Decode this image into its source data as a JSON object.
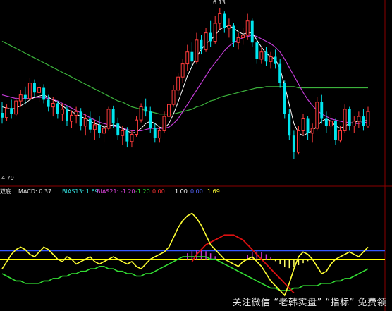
{
  "header": {
    "indicator_label": "双底",
    "macd_label": "MACD: 0.37",
    "bias13_label": "BIAS13: 1.69",
    "bias21_label": "BIAS21: -1.20",
    "extra_value_1": "-1.20",
    "extra_value_2": "0.00",
    "extra_value_3": "1.00",
    "extra_value_4": "0.00",
    "extra_value_5": "1.69"
  },
  "price_panel": {
    "high_label": "6.13",
    "low_label": "4.79"
  },
  "watermark": "关注微信 “老韩实盘” “指标” 免费领",
  "colors": {
    "up": "#ff3b3b",
    "down": "#00e5ee",
    "ma_short": "#ffffff",
    "ma_mid": "#c23bd6",
    "ma_long": "#3cb33c",
    "grid": "#8b0000",
    "bias_fast": "#ffff33",
    "bias_slow": "#33dd33",
    "bias_red": "#dd1111",
    "baseline_blue": "#3355ff",
    "baseline_yellow": "#ffff00"
  },
  "chart_data": {
    "type": "candlestick",
    "title": "",
    "candles": [
      {
        "o": 5.25,
        "h": 5.34,
        "l": 5.16,
        "c": 5.21
      },
      {
        "o": 5.21,
        "h": 5.32,
        "l": 5.18,
        "c": 5.29
      },
      {
        "o": 5.29,
        "h": 5.36,
        "l": 5.2,
        "c": 5.24
      },
      {
        "o": 5.24,
        "h": 5.38,
        "l": 5.22,
        "c": 5.35
      },
      {
        "o": 5.35,
        "h": 5.44,
        "l": 5.3,
        "c": 5.4
      },
      {
        "o": 5.4,
        "h": 5.47,
        "l": 5.32,
        "c": 5.37
      },
      {
        "o": 5.37,
        "h": 5.54,
        "l": 5.35,
        "c": 5.5
      },
      {
        "o": 5.5,
        "h": 5.53,
        "l": 5.38,
        "c": 5.42
      },
      {
        "o": 5.42,
        "h": 5.5,
        "l": 5.34,
        "c": 5.46
      },
      {
        "o": 5.46,
        "h": 5.49,
        "l": 5.33,
        "c": 5.36
      },
      {
        "o": 5.36,
        "h": 5.4,
        "l": 5.26,
        "c": 5.3
      },
      {
        "o": 5.3,
        "h": 5.38,
        "l": 5.22,
        "c": 5.33
      },
      {
        "o": 5.33,
        "h": 5.35,
        "l": 5.2,
        "c": 5.24
      },
      {
        "o": 5.24,
        "h": 5.33,
        "l": 5.18,
        "c": 5.28
      },
      {
        "o": 5.28,
        "h": 5.31,
        "l": 5.14,
        "c": 5.18
      },
      {
        "o": 5.18,
        "h": 5.27,
        "l": 5.12,
        "c": 5.23
      },
      {
        "o": 5.23,
        "h": 5.3,
        "l": 5.16,
        "c": 5.26
      },
      {
        "o": 5.26,
        "h": 5.29,
        "l": 5.1,
        "c": 5.14
      },
      {
        "o": 5.14,
        "h": 5.24,
        "l": 5.06,
        "c": 5.2
      },
      {
        "o": 5.2,
        "h": 5.26,
        "l": 5.08,
        "c": 5.11
      },
      {
        "o": 5.11,
        "h": 5.19,
        "l": 5.02,
        "c": 5.15
      },
      {
        "o": 5.15,
        "h": 5.22,
        "l": 5.04,
        "c": 5.08
      },
      {
        "o": 5.08,
        "h": 5.16,
        "l": 5.0,
        "c": 5.12
      },
      {
        "o": 5.12,
        "h": 5.3,
        "l": 5.1,
        "c": 5.28
      },
      {
        "o": 5.28,
        "h": 5.31,
        "l": 5.12,
        "c": 5.16
      },
      {
        "o": 5.16,
        "h": 5.21,
        "l": 5.02,
        "c": 5.06
      },
      {
        "o": 5.06,
        "h": 5.14,
        "l": 4.98,
        "c": 5.1
      },
      {
        "o": 5.1,
        "h": 5.13,
        "l": 4.96,
        "c": 5.01
      },
      {
        "o": 5.01,
        "h": 5.1,
        "l": 4.96,
        "c": 5.07
      },
      {
        "o": 5.07,
        "h": 5.22,
        "l": 5.05,
        "c": 5.19
      },
      {
        "o": 5.19,
        "h": 5.33,
        "l": 5.17,
        "c": 5.3
      },
      {
        "o": 5.3,
        "h": 5.37,
        "l": 5.22,
        "c": 5.26
      },
      {
        "o": 5.26,
        "h": 5.3,
        "l": 5.08,
        "c": 5.12
      },
      {
        "o": 5.12,
        "h": 5.16,
        "l": 5.0,
        "c": 5.04
      },
      {
        "o": 5.04,
        "h": 5.13,
        "l": 5.0,
        "c": 5.1
      },
      {
        "o": 5.1,
        "h": 5.26,
        "l": 5.08,
        "c": 5.22
      },
      {
        "o": 5.22,
        "h": 5.36,
        "l": 5.2,
        "c": 5.32
      },
      {
        "o": 5.32,
        "h": 5.48,
        "l": 5.3,
        "c": 5.44
      },
      {
        "o": 5.44,
        "h": 5.58,
        "l": 5.4,
        "c": 5.55
      },
      {
        "o": 5.55,
        "h": 5.7,
        "l": 5.5,
        "c": 5.66
      },
      {
        "o": 5.66,
        "h": 5.82,
        "l": 5.6,
        "c": 5.76
      },
      {
        "o": 5.76,
        "h": 5.84,
        "l": 5.62,
        "c": 5.68
      },
      {
        "o": 5.68,
        "h": 5.92,
        "l": 5.66,
        "c": 5.86
      },
      {
        "o": 5.86,
        "h": 5.9,
        "l": 5.74,
        "c": 5.78
      },
      {
        "o": 5.78,
        "h": 5.96,
        "l": 5.76,
        "c": 5.92
      },
      {
        "o": 5.92,
        "h": 6.02,
        "l": 5.8,
        "c": 5.85
      },
      {
        "o": 5.85,
        "h": 6.06,
        "l": 5.83,
        "c": 6.0
      },
      {
        "o": 6.0,
        "h": 6.13,
        "l": 5.95,
        "c": 6.08
      },
      {
        "o": 6.08,
        "h": 6.1,
        "l": 5.92,
        "c": 5.96
      },
      {
        "o": 5.96,
        "h": 6.04,
        "l": 5.88,
        "c": 5.98
      },
      {
        "o": 5.98,
        "h": 6.0,
        "l": 5.8,
        "c": 5.84
      },
      {
        "o": 5.84,
        "h": 5.92,
        "l": 5.78,
        "c": 5.88
      },
      {
        "o": 5.88,
        "h": 5.96,
        "l": 5.82,
        "c": 5.9
      },
      {
        "o": 5.9,
        "h": 6.08,
        "l": 5.86,
        "c": 6.02
      },
      {
        "o": 6.02,
        "h": 6.04,
        "l": 5.8,
        "c": 5.84
      },
      {
        "o": 5.84,
        "h": 5.88,
        "l": 5.66,
        "c": 5.7
      },
      {
        "o": 5.7,
        "h": 5.8,
        "l": 5.66,
        "c": 5.76
      },
      {
        "o": 5.76,
        "h": 5.8,
        "l": 5.64,
        "c": 5.68
      },
      {
        "o": 5.68,
        "h": 5.76,
        "l": 5.62,
        "c": 5.72
      },
      {
        "o": 5.72,
        "h": 5.78,
        "l": 5.62,
        "c": 5.66
      },
      {
        "o": 5.66,
        "h": 5.7,
        "l": 5.46,
        "c": 5.5
      },
      {
        "o": 5.5,
        "h": 5.52,
        "l": 5.2,
        "c": 5.24
      },
      {
        "o": 5.24,
        "h": 5.28,
        "l": 5.02,
        "c": 5.06
      },
      {
        "o": 5.06,
        "h": 5.1,
        "l": 4.86,
        "c": 4.92
      },
      {
        "o": 4.92,
        "h": 5.14,
        "l": 4.9,
        "c": 5.1
      },
      {
        "o": 5.1,
        "h": 5.24,
        "l": 5.06,
        "c": 5.2
      },
      {
        "o": 5.2,
        "h": 5.22,
        "l": 5.02,
        "c": 5.08
      },
      {
        "o": 5.08,
        "h": 5.16,
        "l": 5.0,
        "c": 5.12
      },
      {
        "o": 5.12,
        "h": 5.38,
        "l": 5.1,
        "c": 5.34
      },
      {
        "o": 5.34,
        "h": 5.4,
        "l": 5.16,
        "c": 5.2
      },
      {
        "o": 5.2,
        "h": 5.26,
        "l": 5.08,
        "c": 5.14
      },
      {
        "o": 5.14,
        "h": 5.24,
        "l": 5.06,
        "c": 5.18
      },
      {
        "o": 5.18,
        "h": 5.2,
        "l": 4.98,
        "c": 5.02
      },
      {
        "o": 5.02,
        "h": 5.14,
        "l": 5.0,
        "c": 5.1
      },
      {
        "o": 5.1,
        "h": 5.32,
        "l": 5.08,
        "c": 5.28
      },
      {
        "o": 5.28,
        "h": 5.3,
        "l": 5.1,
        "c": 5.14
      },
      {
        "o": 5.14,
        "h": 5.22,
        "l": 5.08,
        "c": 5.18
      },
      {
        "o": 5.18,
        "h": 5.26,
        "l": 5.12,
        "c": 5.22
      },
      {
        "o": 5.22,
        "h": 5.28,
        "l": 5.1,
        "c": 5.14
      },
      {
        "o": 5.14,
        "h": 5.3,
        "l": 5.12,
        "c": 5.26
      }
    ],
    "ma_short": [
      5.3,
      5.29,
      5.28,
      5.29,
      5.31,
      5.33,
      5.36,
      5.38,
      5.39,
      5.4,
      5.38,
      5.36,
      5.34,
      5.31,
      5.28,
      5.26,
      5.24,
      5.22,
      5.2,
      5.18,
      5.16,
      5.15,
      5.13,
      5.14,
      5.15,
      5.14,
      5.12,
      5.1,
      5.08,
      5.09,
      5.12,
      5.16,
      5.18,
      5.16,
      5.13,
      5.12,
      5.16,
      5.24,
      5.34,
      5.45,
      5.56,
      5.64,
      5.72,
      5.78,
      5.83,
      5.86,
      5.9,
      5.95,
      5.97,
      5.98,
      5.96,
      5.93,
      5.91,
      5.92,
      5.92,
      5.86,
      5.8,
      5.75,
      5.72,
      5.7,
      5.62,
      5.48,
      5.32,
      5.16,
      5.08,
      5.06,
      5.08,
      5.1,
      5.14,
      5.18,
      5.2,
      5.18,
      5.14,
      5.12,
      5.14,
      5.16,
      5.17,
      5.18,
      5.18,
      5.19
    ],
    "ma_mid": [
      5.4,
      5.39,
      5.38,
      5.37,
      5.37,
      5.37,
      5.37,
      5.38,
      5.38,
      5.38,
      5.37,
      5.36,
      5.35,
      5.33,
      5.31,
      5.29,
      5.27,
      5.25,
      5.23,
      5.21,
      5.19,
      5.17,
      5.16,
      5.15,
      5.14,
      5.13,
      5.12,
      5.11,
      5.1,
      5.1,
      5.1,
      5.11,
      5.12,
      5.12,
      5.12,
      5.12,
      5.13,
      5.16,
      5.2,
      5.26,
      5.32,
      5.38,
      5.44,
      5.5,
      5.56,
      5.62,
      5.67,
      5.72,
      5.77,
      5.81,
      5.84,
      5.86,
      5.88,
      5.89,
      5.9,
      5.89,
      5.87,
      5.85,
      5.83,
      5.8,
      5.76,
      5.7,
      5.63,
      5.56,
      5.49,
      5.42,
      5.36,
      5.31,
      5.27,
      5.24,
      5.22,
      5.2,
      5.19,
      5.18,
      5.17,
      5.17,
      5.16,
      5.16,
      5.17,
      5.17
    ],
    "ma_long": [
      5.85,
      5.83,
      5.81,
      5.79,
      5.77,
      5.75,
      5.73,
      5.71,
      5.69,
      5.67,
      5.65,
      5.63,
      5.61,
      5.59,
      5.57,
      5.55,
      5.53,
      5.51,
      5.49,
      5.47,
      5.45,
      5.43,
      5.41,
      5.39,
      5.37,
      5.35,
      5.34,
      5.32,
      5.3,
      5.29,
      5.28,
      5.27,
      5.26,
      5.25,
      5.24,
      5.24,
      5.24,
      5.24,
      5.25,
      5.26,
      5.27,
      5.28,
      5.3,
      5.31,
      5.33,
      5.35,
      5.36,
      5.38,
      5.39,
      5.4,
      5.41,
      5.42,
      5.43,
      5.44,
      5.45,
      5.46,
      5.46,
      5.47,
      5.47,
      5.47,
      5.47,
      5.47,
      5.47,
      5.47,
      5.46,
      5.46,
      5.46,
      5.46,
      5.46,
      5.46,
      5.46,
      5.46,
      5.46,
      5.46,
      5.46,
      5.46,
      5.46,
      5.46,
      5.46,
      5.46
    ],
    "price_ylim": [
      4.73,
      6.16
    ],
    "bias_fast": [
      -4,
      -1,
      2,
      4,
      5,
      4,
      2,
      1,
      3,
      5,
      4,
      2,
      0,
      -1,
      1,
      0,
      -2,
      -1,
      0,
      1,
      -1,
      -2,
      -1,
      0,
      1,
      0,
      -1,
      -2,
      -1,
      -3,
      -4,
      -2,
      0,
      1,
      2,
      3,
      5,
      9,
      13,
      16,
      18,
      19,
      17,
      14,
      10,
      6,
      4,
      2,
      0,
      -1,
      -2,
      -3,
      -1,
      0,
      1,
      -1,
      -3,
      -6,
      -9,
      -11,
      -13,
      -15,
      -10,
      -4,
      1,
      3,
      2,
      0,
      -3,
      -6,
      -5,
      -2,
      0,
      1,
      2,
      3,
      2,
      1,
      3,
      5
    ],
    "bias_slow": [
      -6,
      -7,
      -8,
      -9,
      -9,
      -10,
      -10,
      -10,
      -10,
      -9,
      -9,
      -8,
      -8,
      -7,
      -7,
      -6,
      -6,
      -5,
      -5,
      -4,
      -4,
      -3,
      -3,
      -4,
      -4,
      -5,
      -5,
      -6,
      -6,
      -7,
      -7,
      -6,
      -6,
      -5,
      -4,
      -3,
      -2,
      -1,
      0,
      1,
      1,
      1,
      1,
      1,
      1,
      0,
      0,
      -1,
      -2,
      -3,
      -4,
      -5,
      -6,
      -7,
      -8,
      -9,
      -10,
      -11,
      -12,
      -12,
      -13,
      -13,
      -13,
      -12,
      -12,
      -11,
      -11,
      -11,
      -11,
      -10,
      -10,
      -10,
      -9,
      -9,
      -8,
      -8,
      -7,
      -6,
      -5,
      -4
    ],
    "bias_red": [
      null,
      null,
      null,
      null,
      null,
      null,
      null,
      null,
      null,
      null,
      null,
      null,
      null,
      null,
      null,
      null,
      null,
      null,
      null,
      null,
      null,
      null,
      null,
      null,
      null,
      null,
      null,
      null,
      null,
      null,
      null,
      null,
      null,
      null,
      null,
      null,
      null,
      null,
      null,
      null,
      null,
      -1,
      2,
      4,
      6,
      7,
      8,
      9,
      10,
      10,
      10,
      9,
      8,
      6,
      4,
      2,
      0,
      -2,
      -4,
      -6,
      -8,
      -10,
      -12,
      -14,
      null,
      null,
      null,
      null,
      null,
      null,
      null,
      null,
      null,
      null,
      null,
      null,
      null,
      null,
      null,
      null
    ],
    "macd_hist": [
      0,
      0,
      0,
      0,
      0,
      0,
      0,
      0,
      0,
      0,
      0,
      0,
      0,
      0,
      0,
      0,
      0,
      0,
      0,
      0,
      0,
      0,
      0,
      0,
      0,
      0,
      0,
      0,
      0,
      0,
      0,
      0,
      0,
      0,
      0,
      0,
      0,
      0,
      0,
      0,
      0.6,
      0.8,
      0.9,
      0.9,
      0.8,
      0.6,
      0.3,
      0,
      0,
      0,
      0,
      0,
      0,
      0.4,
      0.7,
      0.8,
      0.7,
      0.5,
      0.2,
      -0.2,
      -0.5,
      -0.8,
      -0.9,
      -0.8,
      -0.6,
      -0.4,
      -0.2,
      0,
      0,
      0,
      0,
      0,
      0,
      0,
      0,
      0,
      0,
      0,
      0,
      0
    ],
    "bias_ylim": [
      -20,
      25
    ]
  }
}
